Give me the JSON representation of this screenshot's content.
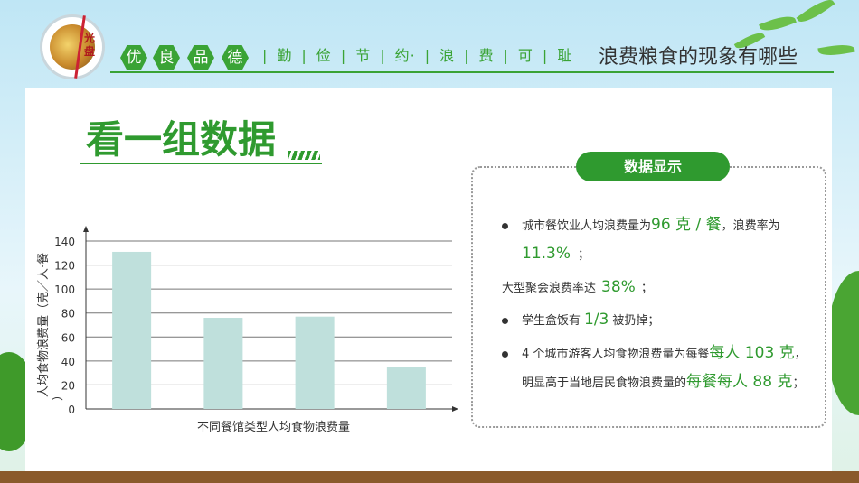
{
  "header": {
    "logo_text": "光盘",
    "badges": [
      "优",
      "良",
      "品",
      "德"
    ],
    "slogan": [
      "勤",
      "俭",
      "节",
      "约·",
      "浪",
      "费",
      "可",
      "耻"
    ],
    "title": "浪费粮食的现象有哪些"
  },
  "section_title": "看一组数据",
  "info": {
    "pill": "数据显示",
    "item1": {
      "pre": "城市餐饮业人均浪费量为",
      "hl1": "96 克 / 餐",
      "mid": "，浪费率为",
      "hl2": "11.3%",
      "post": "；"
    },
    "item2": {
      "pre": "大型聚会浪费率达",
      "hl1": "38%",
      "post": "；"
    },
    "item3": {
      "pre": "学生盒饭有",
      "hl1": "1/3",
      "post": "被扔掉；"
    },
    "item4": {
      "pre": "4 个城市游客人均食物浪费量为每餐",
      "hl1": "每人 103 克",
      "post": "，"
    },
    "item4b": {
      "pre": "明显高于当地居民食物浪费量的",
      "hl1": "每餐每人 88 克",
      "post": "；"
    }
  },
  "colors": {
    "accent": "#2f9a2f",
    "bar": "#bfe0dc"
  },
  "chart_data": {
    "type": "bar",
    "categories": [
      "",
      "",
      "",
      ""
    ],
    "values": [
      131,
      76,
      77,
      35
    ],
    "title": "",
    "xlabel": "不同餐馆类型人均食物浪费量",
    "ylabel": "人均食物浪费量（克／人·餐）",
    "ylim": [
      0,
      140
    ],
    "yticks": [
      0,
      20,
      40,
      60,
      80,
      100,
      120,
      140
    ],
    "grid": true
  }
}
